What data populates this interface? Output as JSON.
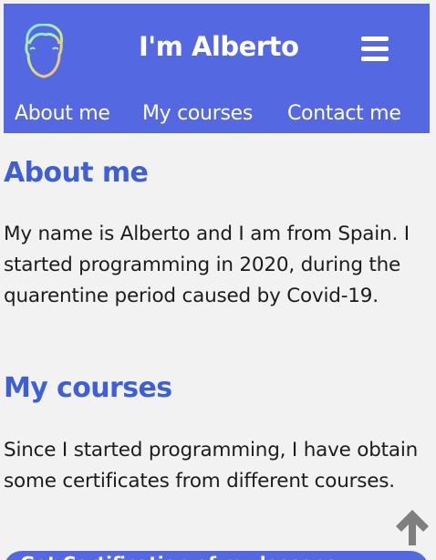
{
  "header": {
    "title": "I'm Alberto",
    "logo_icon": "face-outline-icon",
    "menu_icon": "hamburger-menu-icon"
  },
  "nav": {
    "items": [
      {
        "label": "About me"
      },
      {
        "label": "My courses"
      },
      {
        "label": "Contact me"
      }
    ]
  },
  "sections": {
    "about": {
      "title": "About me",
      "text": "My name is Alberto and I am from Spain. I started programming in 2020, during the quarentine period caused by Covid-19."
    },
    "courses": {
      "title": "My courses",
      "text": "Since I started programming, I have obtain some certificates from different courses."
    }
  },
  "scroll_top_icon": "arrow-up-icon",
  "cta": {
    "label": "Get Certification of my lessons"
  },
  "colors": {
    "header_bg": "#5468e2",
    "heading": "#3f5fd6",
    "page_bg": "#f2f2f2",
    "text": "#1c1c1c"
  }
}
